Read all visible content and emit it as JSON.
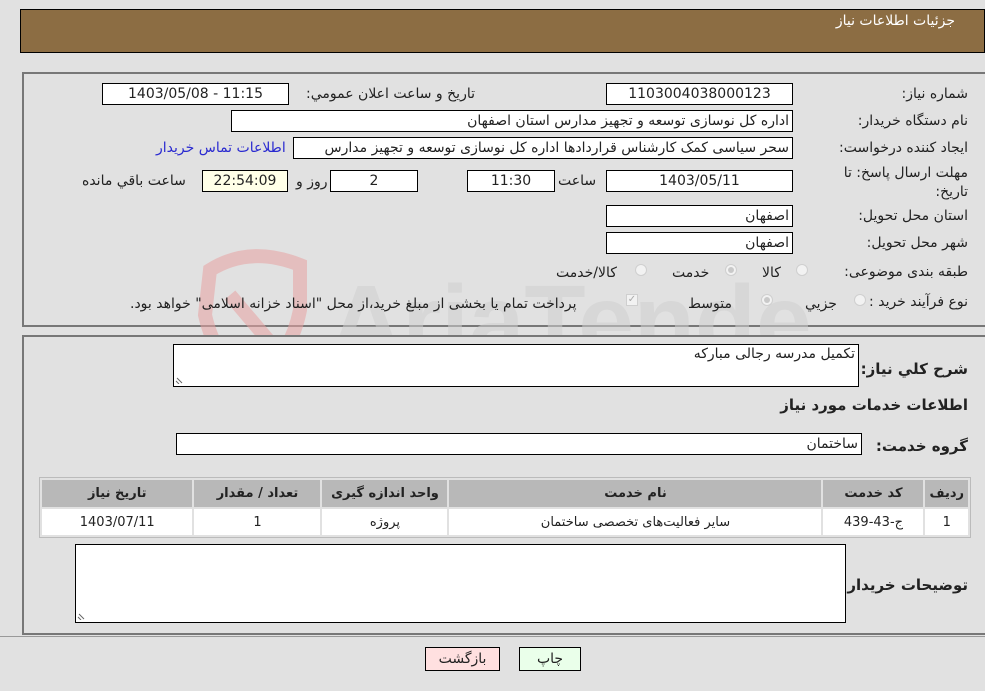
{
  "header": {
    "title": "جزئیات اطلاعات نیاز"
  },
  "form": {
    "need_number": {
      "label": "شماره نیاز:",
      "value": "1103004038000123"
    },
    "announce_datetime": {
      "label": "تاریخ و ساعت اعلان عمومي:",
      "value": "1403/05/08 - 11:15"
    },
    "buyer_org": {
      "label": "نام دستگاه خریدار:",
      "value": "اداره کل نوسازی  توسعه و تجهیز مدارس استان اصفهان"
    },
    "requester": {
      "label": "ایجاد کننده درخواست:",
      "value": "سحر سیاسی کمک کارشناس قراردادها اداره کل نوسازی  توسعه و تجهیز مدارس",
      "contact_link": "اطلاعات تماس خریدار"
    },
    "deadline": {
      "label": "مهلت ارسال پاسخ: تا تاریخ:",
      "date": "1403/05/11",
      "time_label": "ساعت",
      "time": "11:30",
      "days": "2",
      "days_label": "روز و",
      "remaining": "22:54:09",
      "remaining_label": "ساعت باقي مانده"
    },
    "province": {
      "label": "استان محل تحویل:",
      "value": "اصفهان"
    },
    "city": {
      "label": "شهر محل تحویل:",
      "value": "اصفهان"
    },
    "category": {
      "label": "طبقه بندی موضوعی:",
      "options": [
        "کالا",
        "خدمت",
        "کالا/خدمت"
      ],
      "selected": "خدمت"
    },
    "process": {
      "label": "نوع فرآیند خرید :",
      "options": [
        "جزيي",
        "متوسط"
      ],
      "selected": "متوسط",
      "treasury_note": "پرداخت تمام یا بخشی از مبلغ خرید،از محل \"اسناد خزانه اسلامی\" خواهد بود.",
      "treasury_checked": true
    }
  },
  "details": {
    "summary_label": "شرح كلي نياز:",
    "summary_value": "تکمیل مدرسه رجالی مبارکه",
    "services_heading": "اطلاعات خدمات مورد نیاز",
    "service_group_label": "گروه خدمت:",
    "service_group_value": "ساختمان",
    "table": {
      "headers": [
        "ردیف",
        "کد خدمت",
        "نام خدمت",
        "واحد اندازه گیری",
        "تعداد / مقدار",
        "تاریخ نیاز"
      ],
      "rows": [
        [
          "1",
          "ج-43-439",
          "سایر فعالیت‌های تخصصی ساختمان",
          "پروژه",
          "1",
          "1403/07/11"
        ]
      ]
    },
    "buyer_notes_label": "توضیحات خریدار:",
    "buyer_notes_value": ""
  },
  "buttons": {
    "print": "چاپ",
    "back": "بازگشت"
  },
  "watermark": {
    "text": "AriaTender.neT"
  },
  "colors": {
    "header_bg": "#8c6d43",
    "page_bg": "#e1e1e1",
    "link": "#2a2ad0",
    "back_btn": "#ffe0e0",
    "print_btn": "#eaffea"
  }
}
